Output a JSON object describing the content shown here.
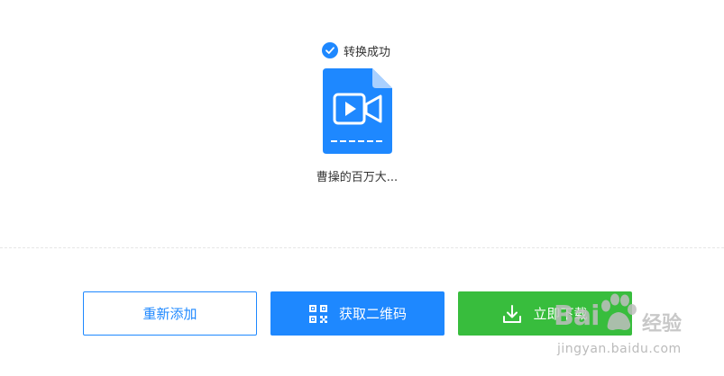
{
  "status": {
    "text": "转换成功"
  },
  "file": {
    "name": "曹操的百万大..."
  },
  "buttons": {
    "readd": "重新添加",
    "qrcode": "获取二维码",
    "download": "立即下载"
  },
  "watermark": {
    "brand": "Bai",
    "brand_suffix": "经验",
    "url": "jingyan.baidu.com"
  },
  "colors": {
    "accent": "#1e88ff",
    "success": "#38bd3d",
    "text": "#333333"
  }
}
